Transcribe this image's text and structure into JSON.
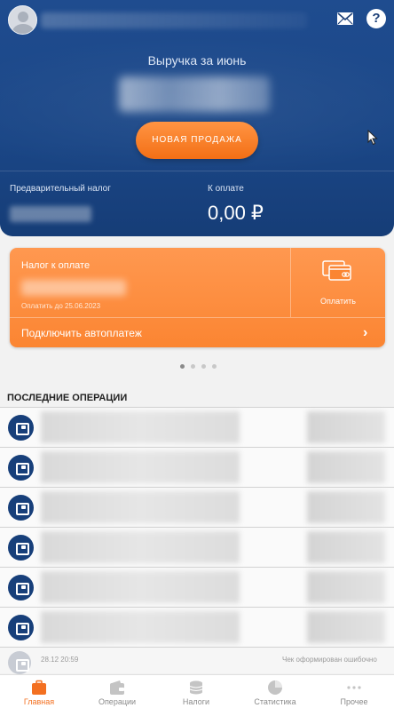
{
  "header": {
    "revenue_title": "Выручка за июнь",
    "new_sale_label": "НОВАЯ ПРОДАЖА",
    "prelim_tax_label": "Предварительный налог",
    "to_pay_label": "К оплате",
    "to_pay_value": "0,00 ₽"
  },
  "tax_card": {
    "title": "Налог к оплате",
    "due_text": "Оплатить до 25.06.2023",
    "pay_label": "Оплатить",
    "autopay_label": "Подключить автоплатеж"
  },
  "carousel": {
    "page_count": 4,
    "active_index": 0
  },
  "operations": {
    "title": "ПОСЛЕДНИЕ ОПЕРАЦИИ",
    "last_time": "28.12 20:59",
    "last_status": "Чек оформирован ошибочно"
  },
  "nav": {
    "items": [
      {
        "label": "Главная",
        "icon": "briefcase-icon",
        "active": true
      },
      {
        "label": "Операции",
        "icon": "wallet-icon",
        "active": false
      },
      {
        "label": "Налоги",
        "icon": "coins-icon",
        "active": false
      },
      {
        "label": "Статистика",
        "icon": "pie-chart-icon",
        "active": false
      },
      {
        "label": "Прочее",
        "icon": "more-icon",
        "active": false
      }
    ]
  },
  "colors": {
    "primary_blue": "#1a4686",
    "accent_orange": "#f37021",
    "card_orange": "#fb8532"
  }
}
